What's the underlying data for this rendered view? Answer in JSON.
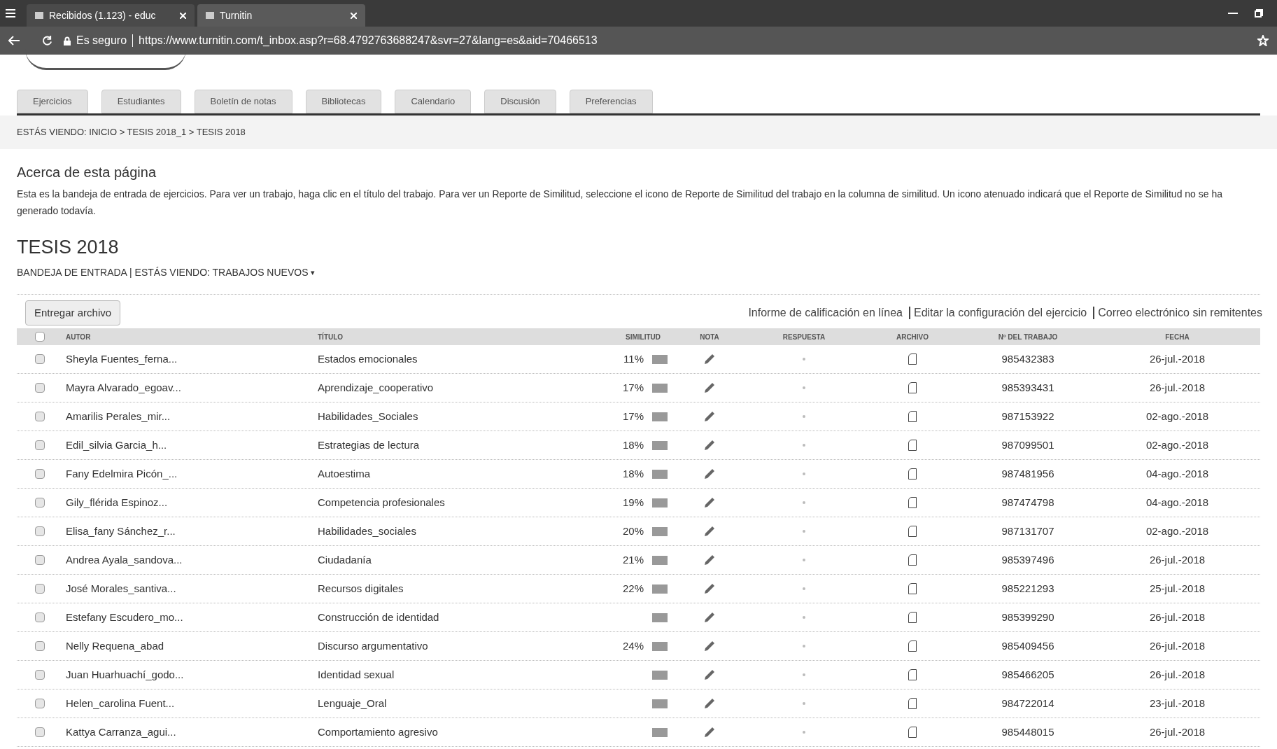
{
  "browser": {
    "tabs": [
      {
        "title": "Recibidos (1.123) - educ",
        "selected": false
      },
      {
        "title": "Turnitin",
        "selected": true
      }
    ],
    "security": "Es seguro",
    "url": "https://www.turnitin.com/t_inbox.asp?r=68.4792763688247&svr=27&lang=es&aid=70466513"
  },
  "nav_tabs": [
    {
      "label": "Ejercicios"
    },
    {
      "label": "Estudiantes"
    },
    {
      "label": "Boletín de notas"
    },
    {
      "label": "Bibliotecas"
    },
    {
      "label": "Calendario"
    },
    {
      "label": "Discusión"
    },
    {
      "label": "Preferencias"
    }
  ],
  "breadcrumb": "ESTÁS VIENDO: INICIO > TESIS 2018_1 > TESIS 2018",
  "about": {
    "title": "Acerca de esta página",
    "text": "Esta es la bandeja de entrada de ejercicios. Para ver un trabajo, haga clic en el título del trabajo. Para ver un Reporte de Similitud, seleccione el icono de Reporte de Similitud del trabajo en la columna de similitud. Un icono atenuado indicará que el Reporte de Similitud no se ha generado todavía."
  },
  "assignment_title": "TESIS 2018",
  "inbox_label": "BANDEJA DE ENTRADA | ESTÁS VIENDO: TRABAJOS NUEVOS",
  "view_caret": "▾",
  "submit_button": "Entregar archivo",
  "links": [
    "Informe de calificación en línea",
    "Editar la configuración del ejercicio",
    "Correo electrónico sin remitentes"
  ],
  "table": {
    "columns": [
      "AUTOR",
      "TÍTULO",
      "SIMILITUD",
      "NOTA",
      "RESPUESTA",
      "ARCHIVO",
      "Nº DEL TRABAJO",
      "FECHA"
    ],
    "select_all_checked": false,
    "rows": [
      {
        "author": "Sheyla Fuentes_ferna...",
        "title": "Estados emocionales",
        "similarity": "11%",
        "paper_id": "985432383",
        "date": "26-jul.-2018",
        "checked": false
      },
      {
        "author": "Mayra Alvarado_egoav...",
        "title": "Aprendizaje_cooperativo",
        "similarity": "17%",
        "paper_id": "985393431",
        "date": "26-jul.-2018",
        "checked": false
      },
      {
        "author": "Amarilis Perales_mir...",
        "title": "Habilidades_Sociales",
        "similarity": "17%",
        "paper_id": "987153922",
        "date": "02-ago.-2018",
        "checked": false
      },
      {
        "author": "Edil_silvia Garcia_h...",
        "title": "Estrategias de lectura",
        "similarity": "18%",
        "paper_id": "987099501",
        "date": "02-ago.-2018",
        "checked": false
      },
      {
        "author": "Fany Edelmira Picón_...",
        "title": "Autoestima",
        "similarity": "18%",
        "paper_id": "987481956",
        "date": "04-ago.-2018",
        "checked": false
      },
      {
        "author": "Gily_flérida Espinoz...",
        "title": "Competencia profesionales",
        "similarity": "19%",
        "paper_id": "987474798",
        "date": "04-ago.-2018",
        "checked": false
      },
      {
        "author": "Elisa_fany Sánchez_r...",
        "title": "Habilidades_sociales",
        "similarity": "20%",
        "paper_id": "987131707",
        "date": "02-ago.-2018",
        "checked": false
      },
      {
        "author": "Andrea Ayala_sandova...",
        "title": "Ciudadanía",
        "similarity": "21%",
        "paper_id": "985397496",
        "date": "26-jul.-2018",
        "checked": false
      },
      {
        "author": "José Morales_santiva...",
        "title": "Recursos digitales",
        "similarity": "22%",
        "paper_id": "985221293",
        "date": "25-jul.-2018",
        "checked": false
      },
      {
        "author": "Estefany Escudero_mo...",
        "title": "Construcción de identidad",
        "paper_id": "985399290",
        "date": "26-jul.-2018",
        "checked": false
      },
      {
        "author": "Nelly Requena_abad",
        "title": "Discurso argumentativo",
        "similarity": "24%",
        "paper_id": "985409456",
        "date": "26-jul.-2018",
        "checked": false
      },
      {
        "author": "Juan Huarhuachí_godo...",
        "title": "Identidad sexual",
        "paper_id": "985466205",
        "date": "26-jul.-2018",
        "checked": false
      },
      {
        "author": "Helen_carolina Fuent...",
        "title": "Lenguaje_Oral",
        "paper_id": "984722014",
        "date": "23-jul.-2018",
        "checked": false
      },
      {
        "author": "Kattya Carranza_agui...",
        "title": "Comportamiento agresivo",
        "paper_id": "985448015",
        "date": "26-jul.-2018",
        "checked": false
      }
    ]
  }
}
